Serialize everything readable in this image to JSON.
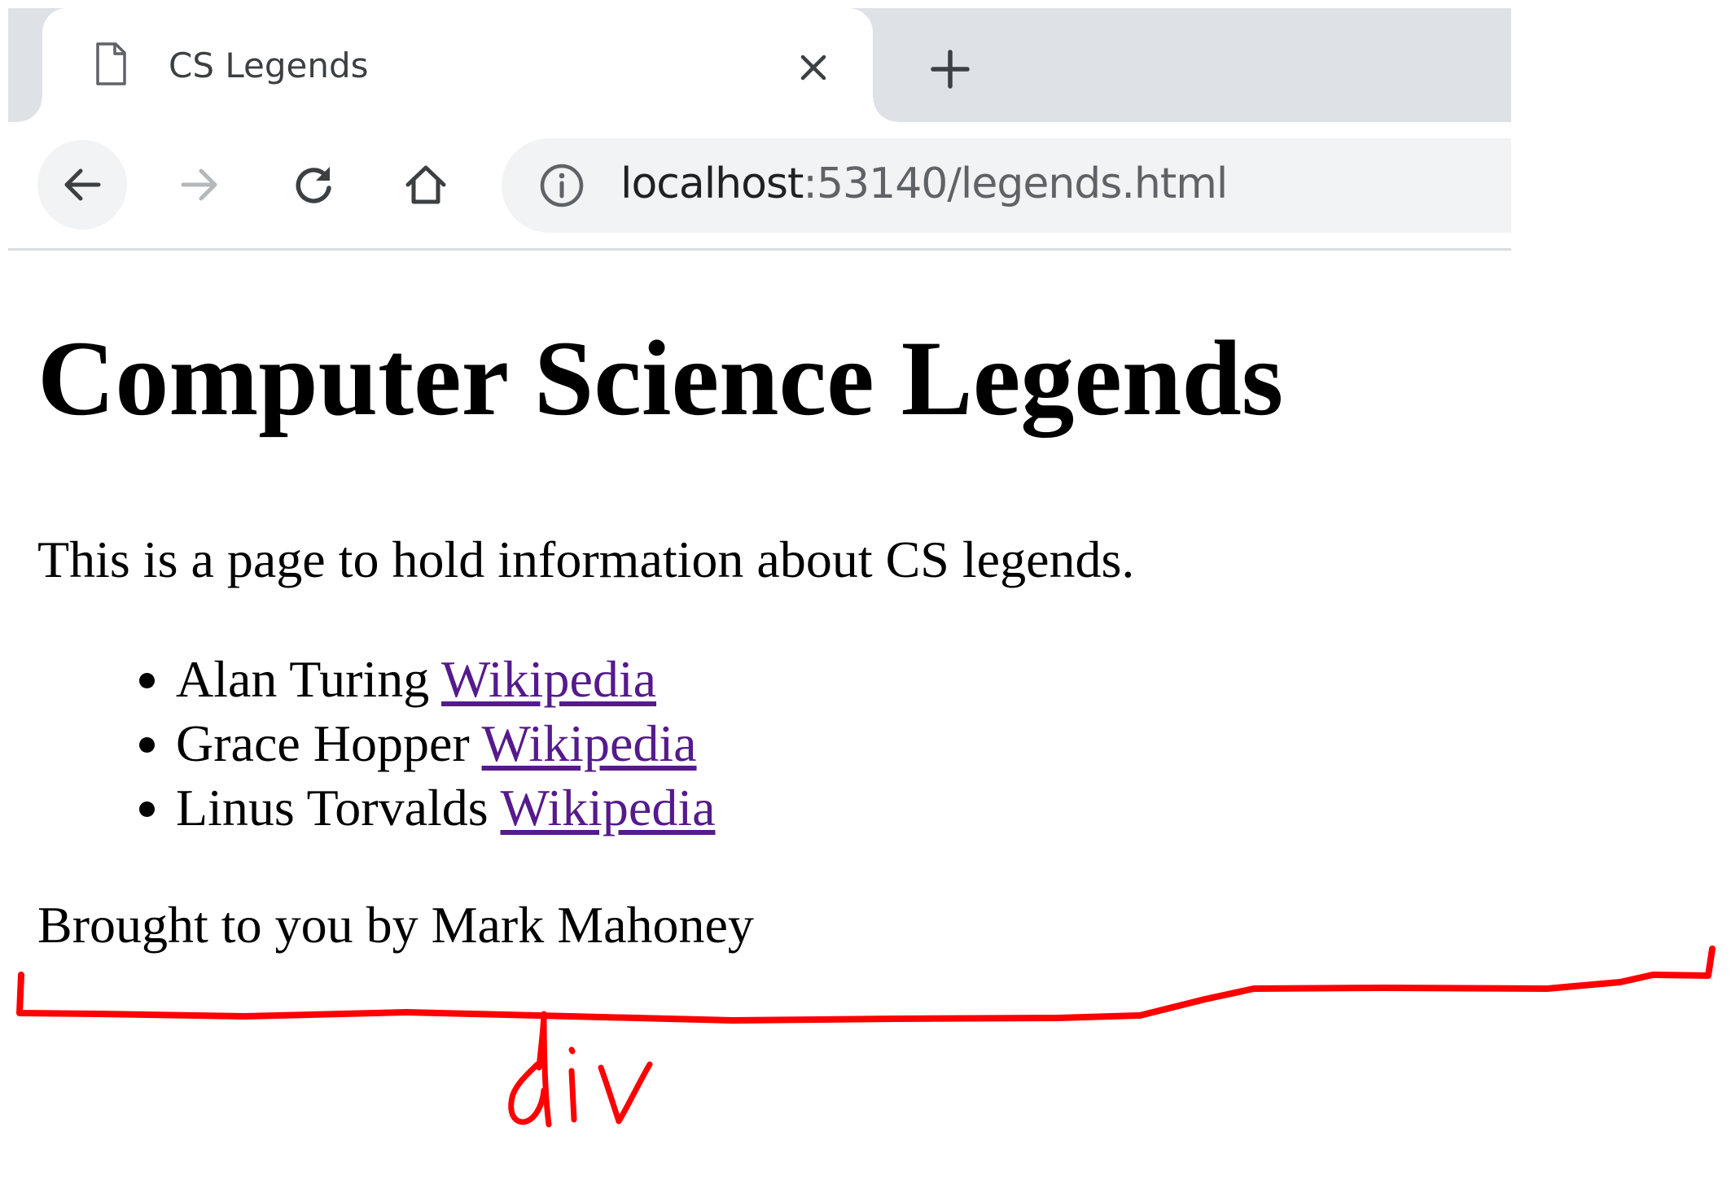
{
  "browser": {
    "tab": {
      "title": "CS Legends",
      "icon": "page-icon",
      "close_icon": "close-icon"
    },
    "new_tab_icon": "plus-icon",
    "toolbar": {
      "back_icon": "arrow-left-icon",
      "forward_icon": "arrow-right-icon",
      "reload_icon": "reload-icon",
      "home_icon": "home-icon"
    },
    "address_bar": {
      "info_icon": "info-icon",
      "url_host": "localhost",
      "url_rest": ":53140/legends.html"
    }
  },
  "page": {
    "heading": "Computer Science Legends",
    "intro": "This is a page to hold information about CS legends.",
    "legends": [
      {
        "name": "Alan Turing",
        "link_text": "Wikipedia"
      },
      {
        "name": "Grace Hopper",
        "link_text": "Wikipedia"
      },
      {
        "name": "Linus Torvalds",
        "link_text": "Wikipedia"
      }
    ],
    "footer": "Brought to you by Mark Mahoney",
    "link_color": "#551a8b"
  },
  "annotation": {
    "label": "div",
    "color": "#ff0000"
  }
}
